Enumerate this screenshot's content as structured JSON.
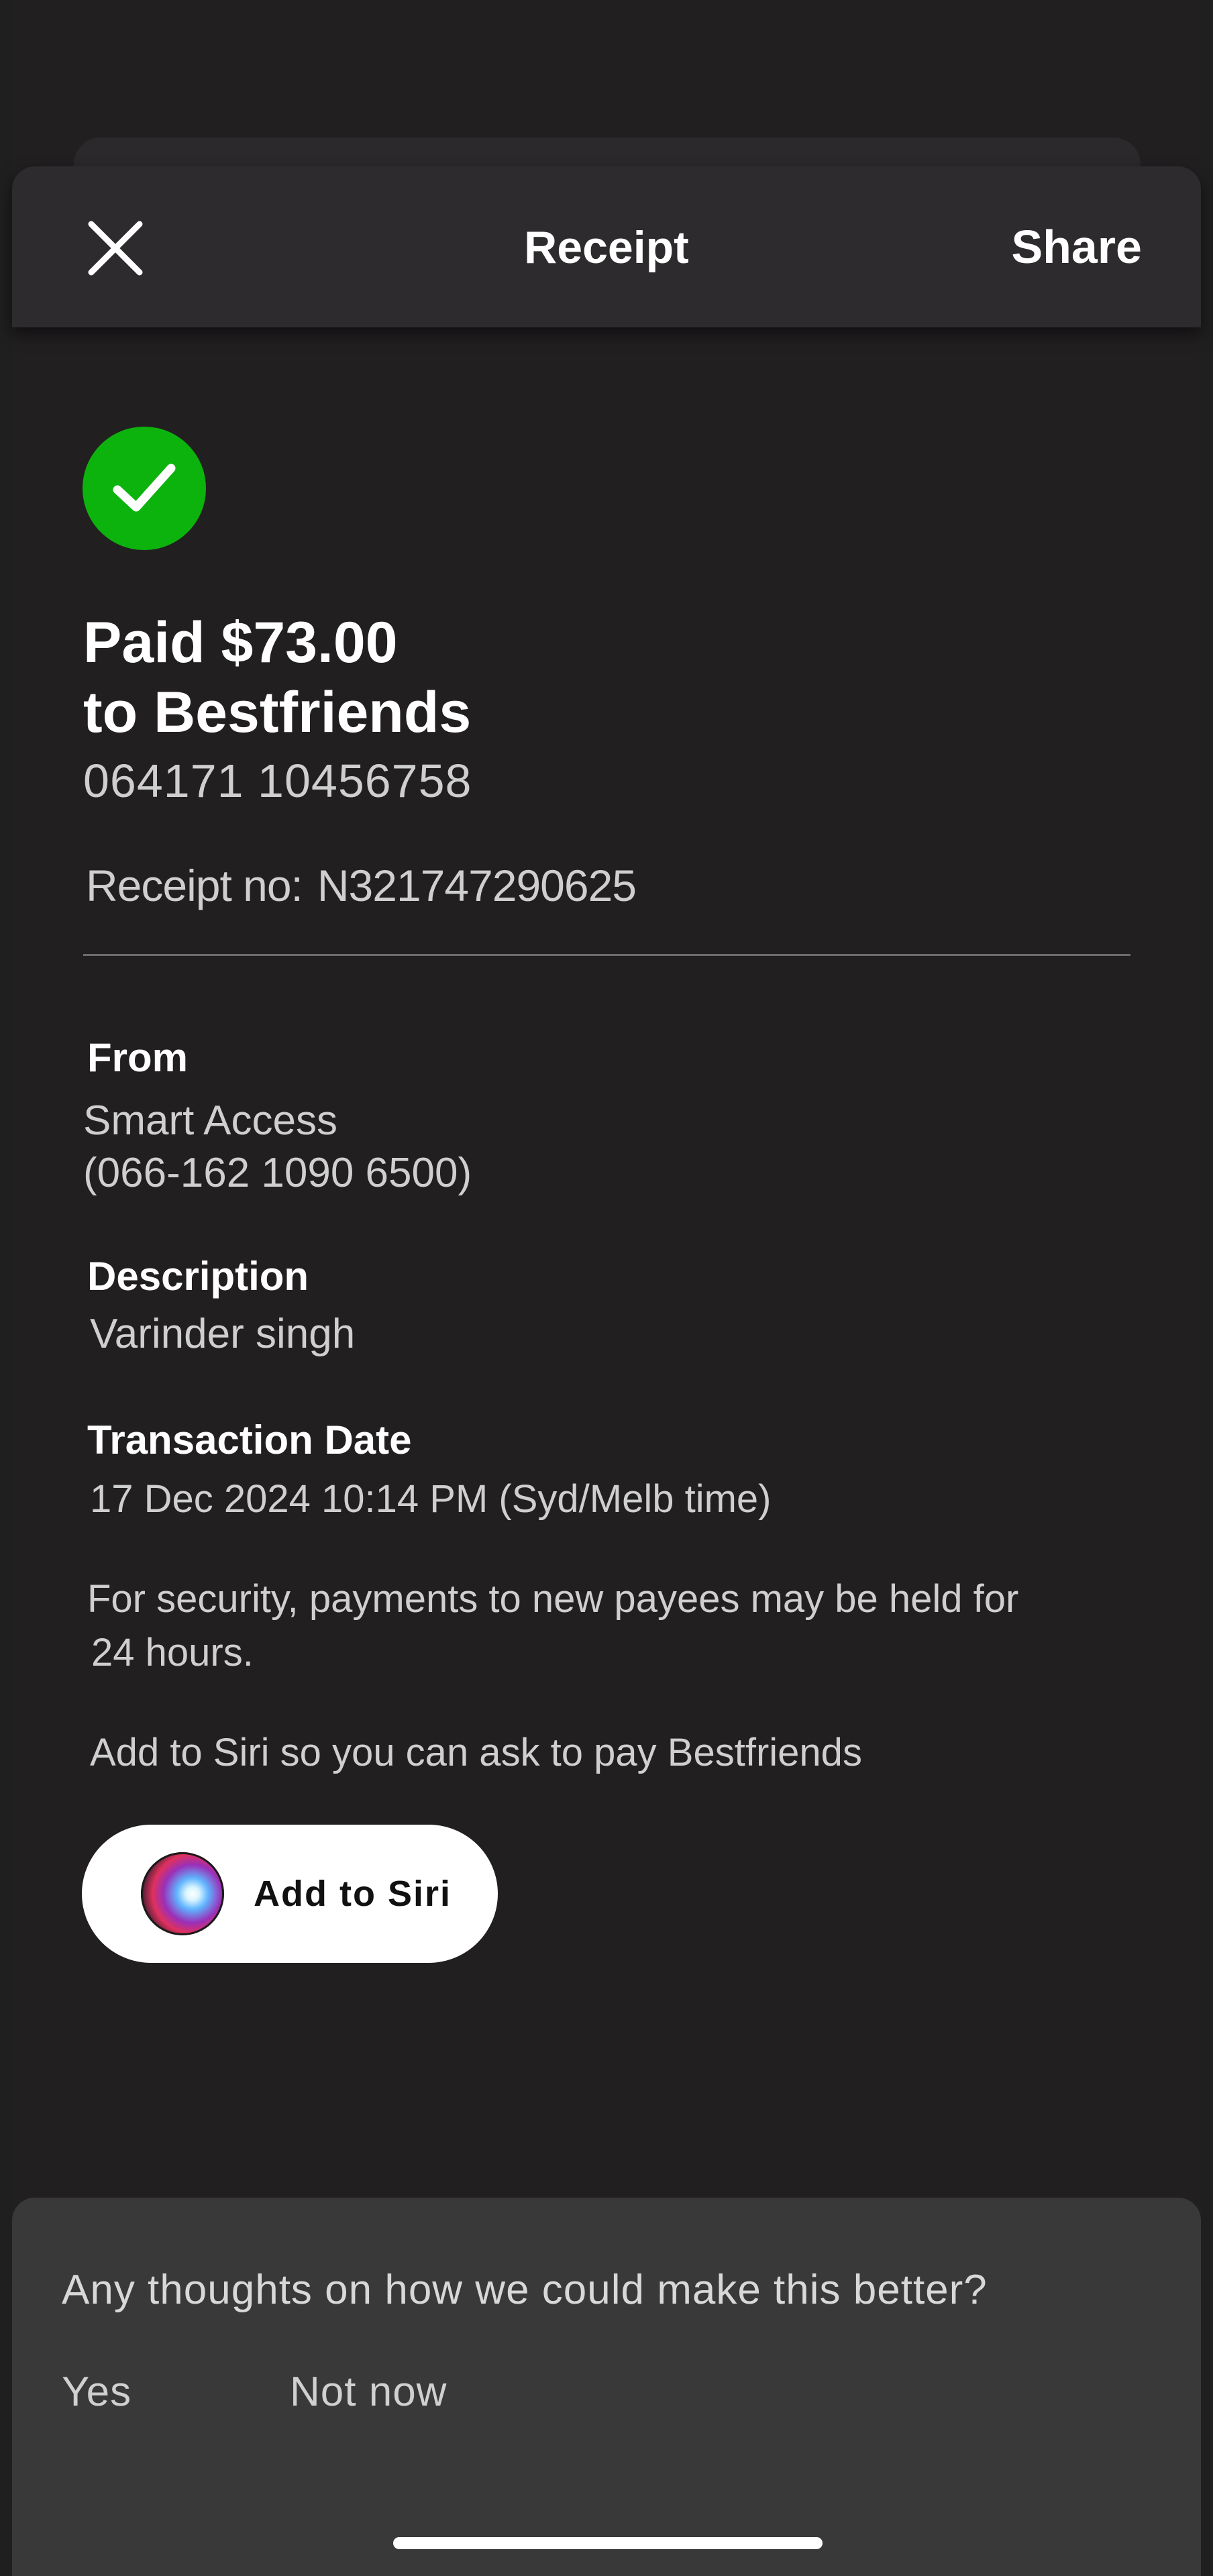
{
  "header": {
    "title": "Receipt",
    "share_label": "Share",
    "close_icon": "close-icon"
  },
  "status": {
    "icon": "check-icon",
    "color": "#0db30d"
  },
  "payment": {
    "paid_line": "Paid $73.00",
    "to_line": "to Bestfriends",
    "account_number": "064171 10456758",
    "receipt_label": "Receipt no:",
    "receipt_number": "N321747290625"
  },
  "details": {
    "from_label": "From",
    "from_account": "Smart Access",
    "from_number": "(066-162 1090 6500)",
    "description_label": "Description",
    "description_value": "Varinder singh",
    "date_label": "Transaction Date",
    "date_value": "17 Dec 2024 10:14 PM (Syd/Melb time)",
    "security_note_line1": "For security, payments to new payees may be held for",
    "security_note_line2": "24 hours.",
    "siri_prompt": "Add to Siri so you can ask to pay Bestfriends"
  },
  "siri_button": {
    "label": "Add to Siri",
    "icon": "siri-icon"
  },
  "feedback": {
    "question": "Any thoughts on how we could make this better?",
    "yes_label": "Yes",
    "not_now_label": "Not now"
  }
}
